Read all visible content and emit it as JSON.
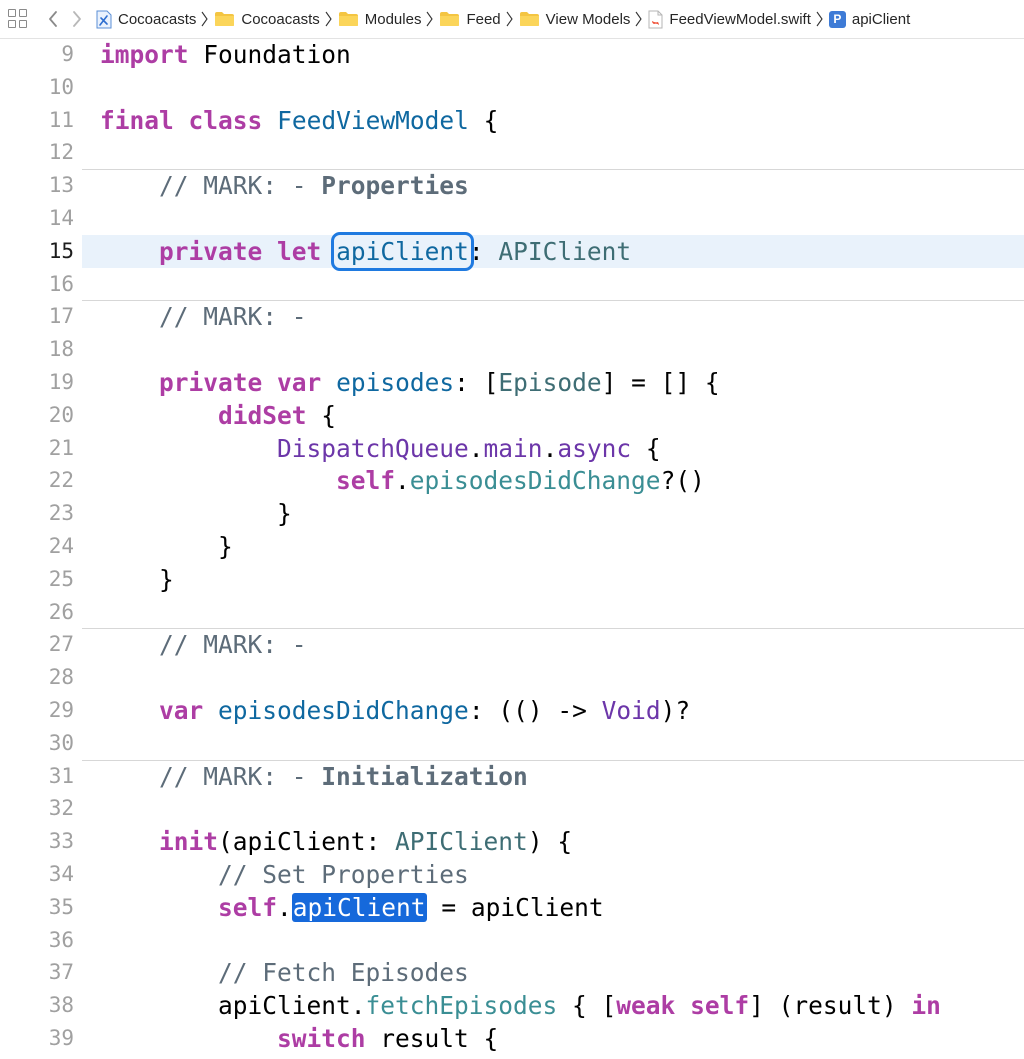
{
  "jumpbar": {
    "crumbs": [
      {
        "label": "Cocoacasts",
        "icon": "xcode-project-icon"
      },
      {
        "label": "Cocoacasts",
        "icon": "folder-icon"
      },
      {
        "label": "Modules",
        "icon": "folder-icon"
      },
      {
        "label": "Feed",
        "icon": "folder-icon"
      },
      {
        "label": "View Models",
        "icon": "folder-icon"
      },
      {
        "label": "FeedViewModel.swift",
        "icon": "swift-file-icon"
      },
      {
        "label": "apiClient",
        "icon": "property-icon",
        "badge": "P"
      }
    ]
  },
  "editor": {
    "current_line": 15,
    "lines": [
      {
        "n": "9",
        "code": "import Foundation"
      },
      {
        "n": "10",
        "code": ""
      },
      {
        "n": "11",
        "code": "final class FeedViewModel {"
      },
      {
        "n": "12",
        "code": ""
      },
      {
        "n": "13",
        "code": "    // MARK: - Properties"
      },
      {
        "n": "14",
        "code": ""
      },
      {
        "n": "15",
        "code": "    private let apiClient: APIClient"
      },
      {
        "n": "16",
        "code": ""
      },
      {
        "n": "17",
        "code": "    // MARK: -"
      },
      {
        "n": "18",
        "code": ""
      },
      {
        "n": "19",
        "code": "    private var episodes: [Episode] = [] {"
      },
      {
        "n": "20",
        "code": "        didSet {"
      },
      {
        "n": "21",
        "code": "            DispatchQueue.main.async {"
      },
      {
        "n": "22",
        "code": "                self.episodesDidChange?()"
      },
      {
        "n": "23",
        "code": "            }"
      },
      {
        "n": "24",
        "code": "        }"
      },
      {
        "n": "25",
        "code": "    }"
      },
      {
        "n": "26",
        "code": ""
      },
      {
        "n": "27",
        "code": "    // MARK: -"
      },
      {
        "n": "28",
        "code": ""
      },
      {
        "n": "29",
        "code": "    var episodesDidChange: (() -> Void)?"
      },
      {
        "n": "30",
        "code": ""
      },
      {
        "n": "31",
        "code": "    // MARK: - Initialization"
      },
      {
        "n": "32",
        "code": ""
      },
      {
        "n": "33",
        "code": "    init(apiClient: APIClient) {"
      },
      {
        "n": "34",
        "code": "        // Set Properties"
      },
      {
        "n": "35",
        "code": "        self.apiClient = apiClient"
      },
      {
        "n": "36",
        "code": ""
      },
      {
        "n": "37",
        "code": "        // Fetch Episodes"
      },
      {
        "n": "38",
        "code": "        apiClient.fetchEpisodes { [weak self] (result) in"
      },
      {
        "n": "39",
        "code": "            switch result {"
      }
    ]
  },
  "colors": {
    "keyword": "#ad3da4",
    "declaration": "#0f68a0",
    "project_type": "#3e6d74",
    "system": "#6c36a9",
    "project_member": "#3a8e94",
    "comment": "#5d6c79",
    "selection": "#1669db",
    "current_line_bg": "#e9f2fb"
  }
}
